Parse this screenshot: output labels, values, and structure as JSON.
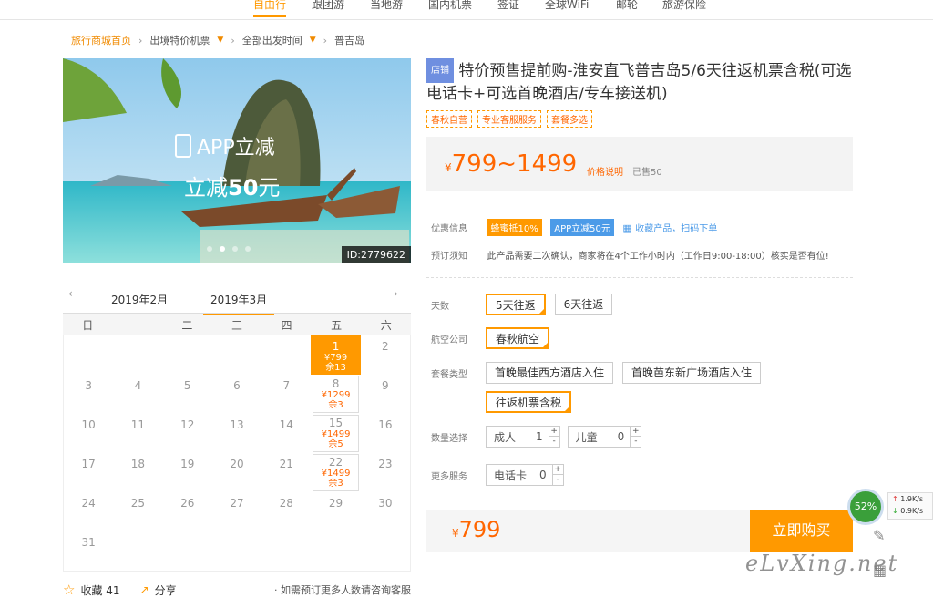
{
  "topnav": [
    "自由行",
    "跟团游",
    "当地游",
    "国内机票",
    "签证",
    "全球WiFi",
    "邮轮",
    "旅游保险"
  ],
  "breadcrumb": {
    "home": "旅行商城首页",
    "level1": "出境特价机票",
    "level2": "全部出发时间",
    "level3": "普吉岛"
  },
  "hero": {
    "line1": "APP立减",
    "line2_pre": "立减",
    "line2_num": "50",
    "line2_unit": "元",
    "id": "ID:2779622"
  },
  "calendar": {
    "prev_month": "2019年2月",
    "cur_month": "2019年3月",
    "weekdays": [
      "日",
      "一",
      "二",
      "三",
      "四",
      "五",
      "六"
    ],
    "days": [
      {
        "d": "",
        "p": "",
        "r": ""
      },
      {
        "d": "",
        "p": "",
        "r": ""
      },
      {
        "d": "",
        "p": "",
        "r": ""
      },
      {
        "d": "",
        "p": "",
        "r": ""
      },
      {
        "d": "",
        "p": "",
        "r": ""
      },
      {
        "d": "1",
        "p": "¥799",
        "r": "余13"
      },
      {
        "d": "2",
        "p": "",
        "r": ""
      },
      {
        "d": "3",
        "p": "",
        "r": ""
      },
      {
        "d": "4",
        "p": "",
        "r": ""
      },
      {
        "d": "5",
        "p": "",
        "r": ""
      },
      {
        "d": "6",
        "p": "",
        "r": ""
      },
      {
        "d": "7",
        "p": "",
        "r": ""
      },
      {
        "d": "8",
        "p": "¥1299",
        "r": "余3"
      },
      {
        "d": "9",
        "p": "",
        "r": ""
      },
      {
        "d": "10",
        "p": "",
        "r": ""
      },
      {
        "d": "11",
        "p": "",
        "r": ""
      },
      {
        "d": "12",
        "p": "",
        "r": ""
      },
      {
        "d": "13",
        "p": "",
        "r": ""
      },
      {
        "d": "14",
        "p": "",
        "r": ""
      },
      {
        "d": "15",
        "p": "¥1499",
        "r": "余5"
      },
      {
        "d": "16",
        "p": "",
        "r": ""
      },
      {
        "d": "17",
        "p": "",
        "r": ""
      },
      {
        "d": "18",
        "p": "",
        "r": ""
      },
      {
        "d": "19",
        "p": "",
        "r": ""
      },
      {
        "d": "20",
        "p": "",
        "r": ""
      },
      {
        "d": "21",
        "p": "",
        "r": ""
      },
      {
        "d": "22",
        "p": "¥1499",
        "r": "余3"
      },
      {
        "d": "23",
        "p": "",
        "r": ""
      },
      {
        "d": "24",
        "p": "",
        "r": ""
      },
      {
        "d": "25",
        "p": "",
        "r": ""
      },
      {
        "d": "26",
        "p": "",
        "r": ""
      },
      {
        "d": "27",
        "p": "",
        "r": ""
      },
      {
        "d": "28",
        "p": "",
        "r": ""
      },
      {
        "d": "29",
        "p": "",
        "r": ""
      },
      {
        "d": "30",
        "p": "",
        "r": ""
      },
      {
        "d": "31",
        "p": "",
        "r": ""
      }
    ]
  },
  "footer": {
    "fav": "收藏 41",
    "share": "分享",
    "note": "· 如需预订更多人数请咨询客服"
  },
  "product": {
    "shop_tag": "店铺",
    "title": "特价预售提前购-淮安直飞普吉岛5/6天往返机票含税(可选电话卡+可选首晚酒店/专车接送机)",
    "tags": [
      "春秋自营",
      "专业客服服务",
      "套餐多选"
    ],
    "price_range": "799~1499",
    "price_explain": "价格说明",
    "sold": "已售50",
    "promo_label": "优惠信息",
    "promo1": "蜂蜜抵10%",
    "promo2": "APP立减50元",
    "collect": "收藏产品，扫码下单",
    "notice_label": "预订须知",
    "notice": "此产品需要二次确认，商家将在4个工作小时内（工作日9:00-18:00）核实是否有位!",
    "days_label": "天数",
    "days_opts": [
      "5天往返",
      "6天往返"
    ],
    "airline_label": "航空公司",
    "airline": "春秋航空",
    "package_label": "套餐类型",
    "pkg_opts": [
      "首晚最佳西方酒店入住",
      "首晚芭东新广场酒店入住",
      "往返机票含税"
    ],
    "qty_label": "数量选择",
    "adult": "成人",
    "adult_val": "1",
    "child": "儿童",
    "child_val": "0",
    "more_label": "更多服务",
    "phonecard": "电话卡",
    "phonecard_val": "0",
    "total": "799",
    "buy": "立即购买"
  },
  "net": {
    "pct": "52%",
    "up": "1.9K/s",
    "down": "0.9K/s"
  },
  "watermark": "eLvXing.net"
}
